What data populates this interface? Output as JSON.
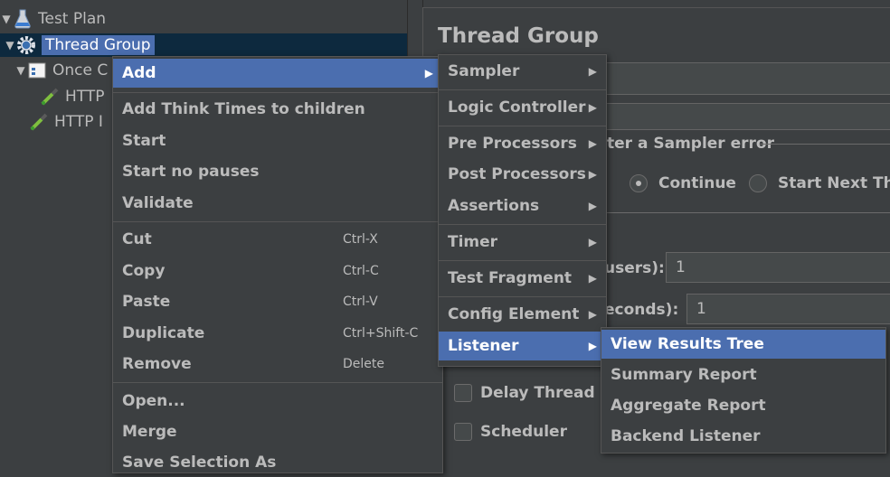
{
  "tree": {
    "test_plan": "Test Plan",
    "thread_group": "Thread Group",
    "once_controller": "Once C",
    "http_1": "HTTP",
    "http_2": "HTTP I"
  },
  "panel": {
    "title": "Thread Group",
    "sampler_error_label": "ter a Sampler error",
    "continue_label": "Continue",
    "start_next_label": "Start Next Thre",
    "users_label": "users):",
    "users_value": "1",
    "seconds_label": "econds):",
    "seconds_value": "1",
    "delay_label": "Delay Thread cr",
    "scheduler_label": "Scheduler"
  },
  "context_menu": {
    "add": "Add",
    "add_think_times": "Add Think Times to children",
    "start": "Start",
    "start_no_pauses": "Start no pauses",
    "validate": "Validate",
    "cut": "Cut",
    "cut_shortcut": "Ctrl-X",
    "copy": "Copy",
    "copy_shortcut": "Ctrl-C",
    "paste": "Paste",
    "paste_shortcut": "Ctrl-V",
    "duplicate": "Duplicate",
    "duplicate_shortcut": "Ctrl+Shift-C",
    "remove": "Remove",
    "remove_shortcut": "Delete",
    "open": "Open...",
    "merge": "Merge",
    "save_selection_as": "Save Selection As"
  },
  "add_submenu": {
    "sampler": "Sampler",
    "logic_controller": "Logic Controller",
    "pre_processors": "Pre Processors",
    "post_processors": "Post Processors",
    "assertions": "Assertions",
    "timer": "Timer",
    "test_fragment": "Test Fragment",
    "config_element": "Config Element",
    "listener": "Listener"
  },
  "listener_submenu": {
    "view_results_tree": "View Results Tree",
    "summary_report": "Summary Report",
    "aggregate_report": "Aggregate Report",
    "backend_listener": "Backend Listener"
  },
  "icons": {
    "submenu_arrow": "▶",
    "expanded": "▼"
  },
  "colors": {
    "background": "#3c3f41",
    "selection": "#4b6eaf",
    "text": "#bbbbbb"
  }
}
